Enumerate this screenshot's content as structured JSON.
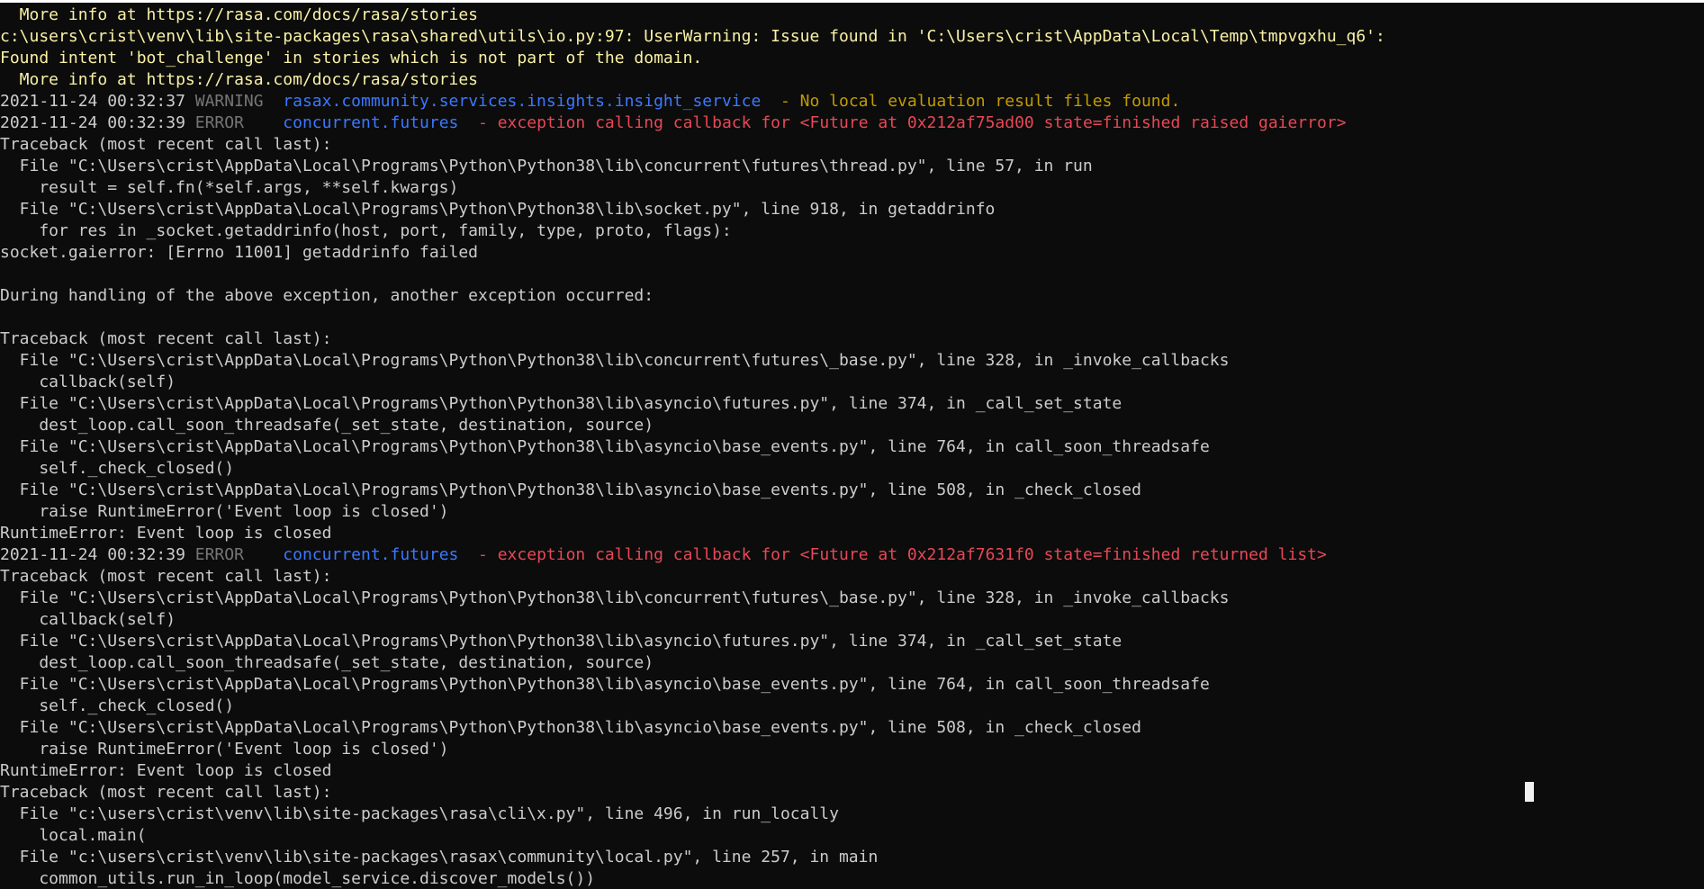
{
  "terminal": {
    "colors": {
      "background": "#0c0c0c",
      "default_text": "#cccccc",
      "warning_text": "#f9f1a5",
      "logger_blue": "#3b78ff",
      "warning_message": "#c19c00",
      "error_message": "#e74856",
      "level_gray": "#767676"
    },
    "lines": [
      [
        {
          "text": "  More info at https://rasa.com/docs/rasa/stories",
          "style": "yellow"
        }
      ],
      [
        {
          "text": "c:\\users\\crist\\venv\\lib\\site-packages\\rasa\\shared\\utils\\io.py:97: UserWarning: Issue found in 'C:\\Users\\crist\\AppData\\Local\\Temp\\tmpvgxhu_q6':",
          "style": "yellow"
        }
      ],
      [
        {
          "text": "Found intent 'bot_challenge' in stories which is not part of the domain.",
          "style": "yellow"
        }
      ],
      [
        {
          "text": "  More info at https://rasa.com/docs/rasa/stories",
          "style": "yellow"
        }
      ],
      [
        {
          "text": "2021-11-24 00:32:37 ",
          "style": "default"
        },
        {
          "text": "WARNING  ",
          "style": "gray"
        },
        {
          "text": "rasax.community.services.insights.insight_service",
          "style": "blue"
        },
        {
          "text": "  - No local evaluation result files found.",
          "style": "gold"
        }
      ],
      [
        {
          "text": "2021-11-24 00:32:39 ",
          "style": "default"
        },
        {
          "text": "ERROR    ",
          "style": "gray"
        },
        {
          "text": "concurrent.futures",
          "style": "blue"
        },
        {
          "text": "  - exception calling callback for <Future at 0x212af75ad00 state=finished raised gaierror>",
          "style": "red"
        }
      ],
      [
        {
          "text": "Traceback (most recent call last):",
          "style": "default"
        }
      ],
      [
        {
          "text": "  File \"C:\\Users\\crist\\AppData\\Local\\Programs\\Python\\Python38\\lib\\concurrent\\futures\\thread.py\", line 57, in run",
          "style": "default"
        }
      ],
      [
        {
          "text": "    result = self.fn(*self.args, **self.kwargs)",
          "style": "default"
        }
      ],
      [
        {
          "text": "  File \"C:\\Users\\crist\\AppData\\Local\\Programs\\Python\\Python38\\lib\\socket.py\", line 918, in getaddrinfo",
          "style": "default"
        }
      ],
      [
        {
          "text": "    for res in _socket.getaddrinfo(host, port, family, type, proto, flags):",
          "style": "default"
        }
      ],
      [
        {
          "text": "socket.gaierror: [Errno 11001] getaddrinfo failed",
          "style": "default"
        }
      ],
      [
        {
          "text": "",
          "style": "default"
        }
      ],
      [
        {
          "text": "During handling of the above exception, another exception occurred:",
          "style": "default"
        }
      ],
      [
        {
          "text": "",
          "style": "default"
        }
      ],
      [
        {
          "text": "Traceback (most recent call last):",
          "style": "default"
        }
      ],
      [
        {
          "text": "  File \"C:\\Users\\crist\\AppData\\Local\\Programs\\Python\\Python38\\lib\\concurrent\\futures\\_base.py\", line 328, in _invoke_callbacks",
          "style": "default"
        }
      ],
      [
        {
          "text": "    callback(self)",
          "style": "default"
        }
      ],
      [
        {
          "text": "  File \"C:\\Users\\crist\\AppData\\Local\\Programs\\Python\\Python38\\lib\\asyncio\\futures.py\", line 374, in _call_set_state",
          "style": "default"
        }
      ],
      [
        {
          "text": "    dest_loop.call_soon_threadsafe(_set_state, destination, source)",
          "style": "default"
        }
      ],
      [
        {
          "text": "  File \"C:\\Users\\crist\\AppData\\Local\\Programs\\Python\\Python38\\lib\\asyncio\\base_events.py\", line 764, in call_soon_threadsafe",
          "style": "default"
        }
      ],
      [
        {
          "text": "    self._check_closed()",
          "style": "default"
        }
      ],
      [
        {
          "text": "  File \"C:\\Users\\crist\\AppData\\Local\\Programs\\Python\\Python38\\lib\\asyncio\\base_events.py\", line 508, in _check_closed",
          "style": "default"
        }
      ],
      [
        {
          "text": "    raise RuntimeError('Event loop is closed')",
          "style": "default"
        }
      ],
      [
        {
          "text": "RuntimeError: Event loop is closed",
          "style": "default"
        }
      ],
      [
        {
          "text": "2021-11-24 00:32:39 ",
          "style": "default"
        },
        {
          "text": "ERROR    ",
          "style": "gray"
        },
        {
          "text": "concurrent.futures",
          "style": "blue"
        },
        {
          "text": "  - exception calling callback for <Future at 0x212af7631f0 state=finished returned list>",
          "style": "red"
        }
      ],
      [
        {
          "text": "Traceback (most recent call last):",
          "style": "default"
        }
      ],
      [
        {
          "text": "  File \"C:\\Users\\crist\\AppData\\Local\\Programs\\Python\\Python38\\lib\\concurrent\\futures\\_base.py\", line 328, in _invoke_callbacks",
          "style": "default"
        }
      ],
      [
        {
          "text": "    callback(self)",
          "style": "default"
        }
      ],
      [
        {
          "text": "  File \"C:\\Users\\crist\\AppData\\Local\\Programs\\Python\\Python38\\lib\\asyncio\\futures.py\", line 374, in _call_set_state",
          "style": "default"
        }
      ],
      [
        {
          "text": "    dest_loop.call_soon_threadsafe(_set_state, destination, source)",
          "style": "default"
        }
      ],
      [
        {
          "text": "  File \"C:\\Users\\crist\\AppData\\Local\\Programs\\Python\\Python38\\lib\\asyncio\\base_events.py\", line 764, in call_soon_threadsafe",
          "style": "default"
        }
      ],
      [
        {
          "text": "    self._check_closed()",
          "style": "default"
        }
      ],
      [
        {
          "text": "  File \"C:\\Users\\crist\\AppData\\Local\\Programs\\Python\\Python38\\lib\\asyncio\\base_events.py\", line 508, in _check_closed",
          "style": "default"
        }
      ],
      [
        {
          "text": "    raise RuntimeError('Event loop is closed')",
          "style": "default"
        }
      ],
      [
        {
          "text": "RuntimeError: Event loop is closed",
          "style": "default"
        }
      ],
      [
        {
          "text": "Traceback (most recent call last):",
          "style": "default"
        }
      ],
      [
        {
          "text": "  File \"c:\\users\\crist\\venv\\lib\\site-packages\\rasa\\cli\\x.py\", line 496, in run_locally",
          "style": "default"
        }
      ],
      [
        {
          "text": "    local.main(",
          "style": "default"
        }
      ],
      [
        {
          "text": "  File \"c:\\users\\crist\\venv\\lib\\site-packages\\rasax\\community\\local.py\", line 257, in main",
          "style": "default"
        }
      ],
      [
        {
          "text": "    common_utils.run_in_loop(model_service.discover_models())",
          "style": "default"
        }
      ]
    ]
  }
}
